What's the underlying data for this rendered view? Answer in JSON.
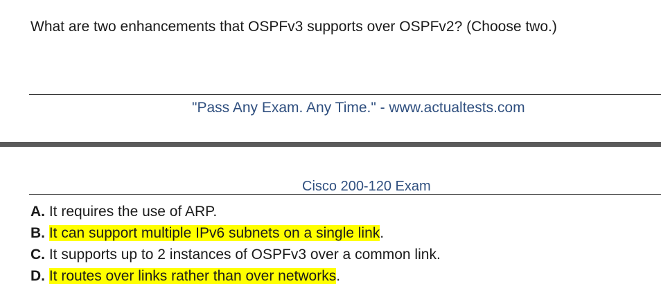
{
  "question": {
    "text": "What are two enhancements that OSPFv3 supports over OSPFv2? (Choose two.)"
  },
  "page_footer": {
    "text": "\"Pass Any Exam. Any Time.\" - www.actualtests.com"
  },
  "page_header": {
    "text": "Cisco 200-120 Exam"
  },
  "options": [
    {
      "letter": "A.",
      "text": "It requires the use of ARP.",
      "highlighted": false
    },
    {
      "letter": "B.",
      "text": "It can support multiple IPv6 subnets on a single link",
      "trailing": ".",
      "highlighted": true
    },
    {
      "letter": "C.",
      "text": "It supports up to 2 instances of OSPFv3 over a common link.",
      "highlighted": false
    },
    {
      "letter": "D.",
      "text": "It routes over links rather than over networks",
      "trailing": ".",
      "highlighted": true
    }
  ],
  "colors": {
    "highlight": "#ffff00",
    "link_text": "#2f4f7f",
    "separator": "#5a5a5a"
  }
}
